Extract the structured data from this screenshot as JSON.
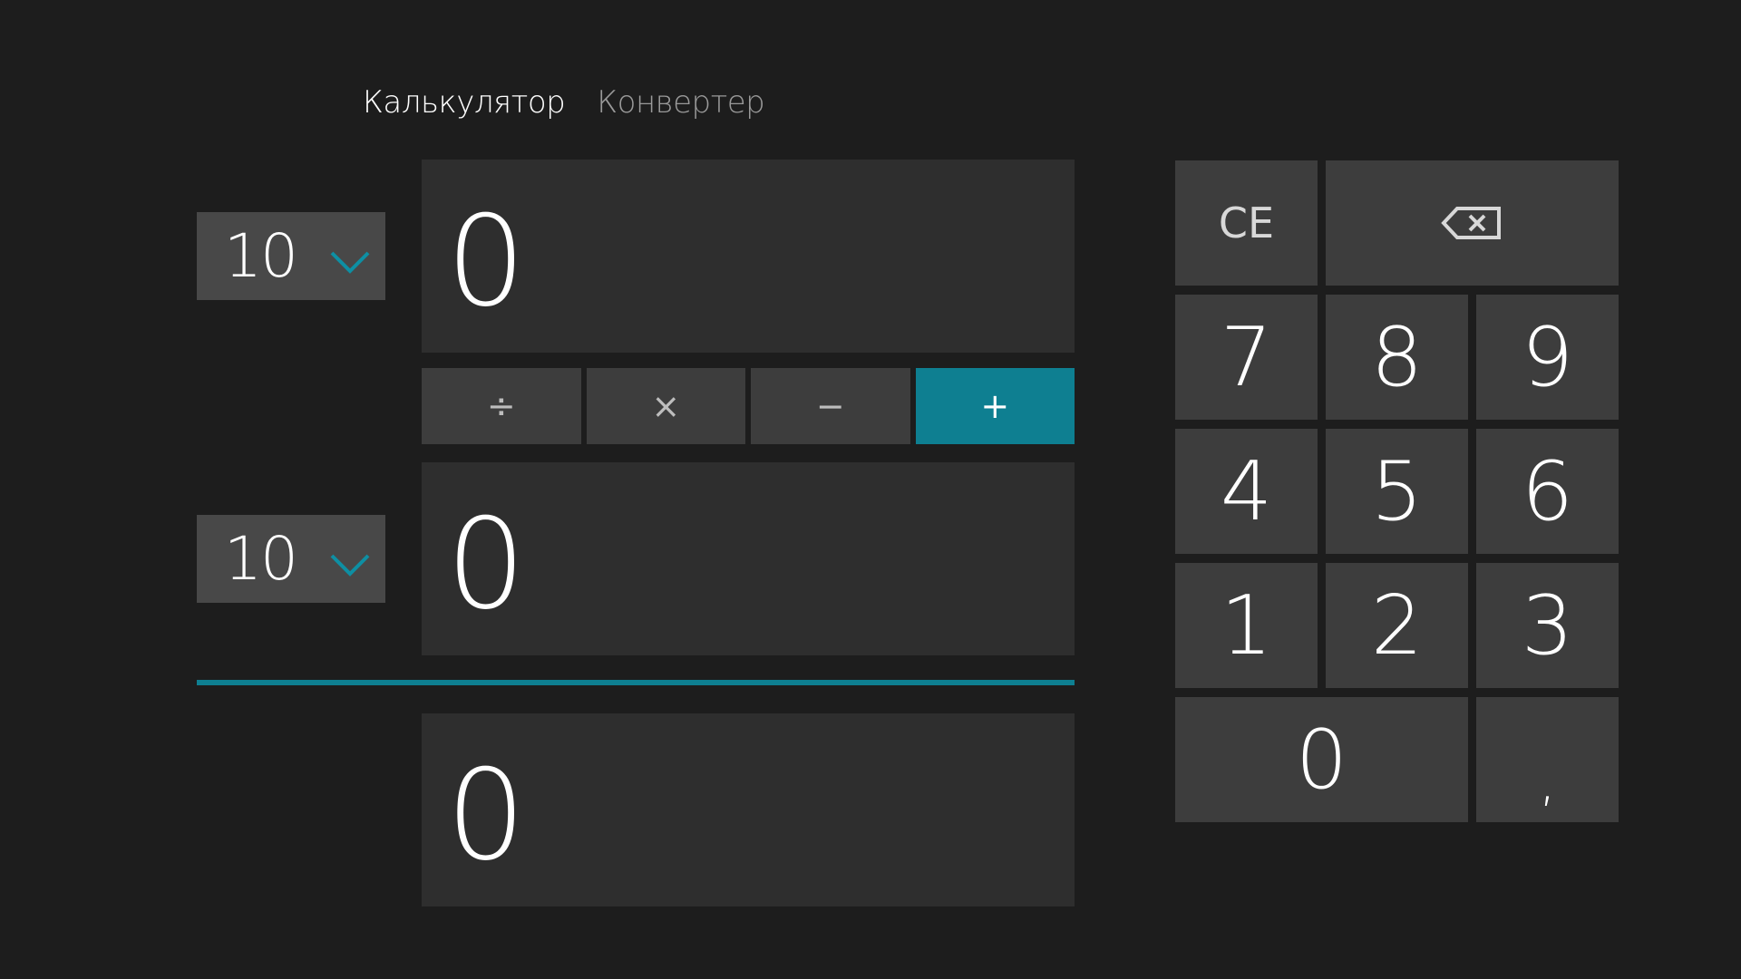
{
  "tabs": [
    {
      "label": "Калькулятор",
      "active": true
    },
    {
      "label": "Конвертер",
      "active": false
    }
  ],
  "operand1": {
    "base": "10",
    "value": "0"
  },
  "operand2": {
    "base": "10",
    "value": "0"
  },
  "result": {
    "value": "0"
  },
  "operators": [
    {
      "label": "÷",
      "name": "divide",
      "active": false
    },
    {
      "label": "×",
      "name": "multiply",
      "active": false
    },
    {
      "label": "−",
      "name": "subtract",
      "active": false
    },
    {
      "label": "+",
      "name": "add",
      "active": true
    }
  ],
  "keypad": {
    "clear_label": "CE",
    "backspace_icon": "backspace-icon",
    "digits": {
      "seven": "7",
      "eight": "8",
      "nine": "9",
      "four": "4",
      "five": "5",
      "six": "6",
      "one": "1",
      "two": "2",
      "three": "3",
      "zero": "0"
    },
    "decimal": ","
  },
  "colors": {
    "background": "#1d1d1d",
    "panel": "#2e2e2e",
    "button": "#3d3d3d",
    "select": "#484848",
    "accent": "#0e7f91"
  }
}
